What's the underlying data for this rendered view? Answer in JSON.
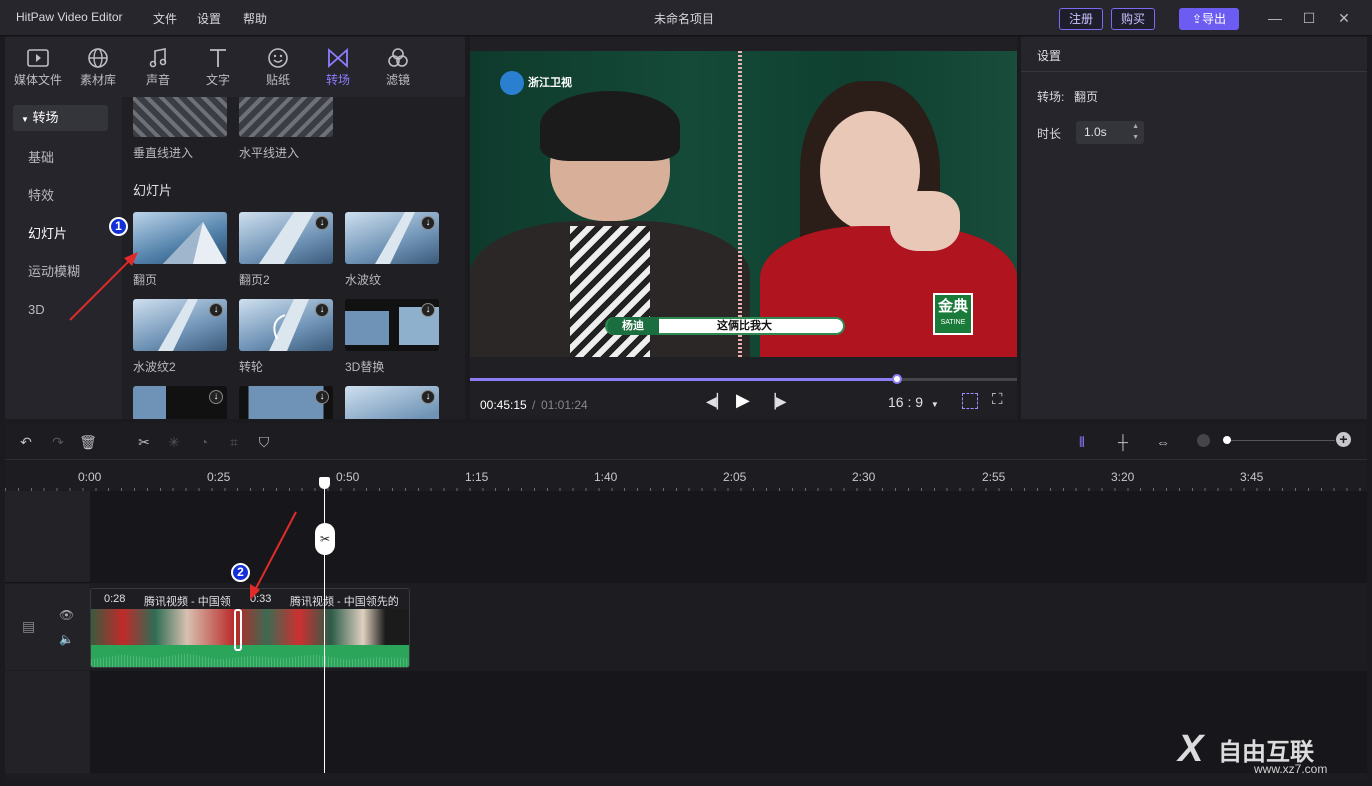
{
  "app": {
    "title": "HitPaw Video Editor",
    "project_name": "未命名项目"
  },
  "menu": [
    "文件",
    "设置",
    "帮助"
  ],
  "header": {
    "register": "注册",
    "buy": "购买",
    "export": "导出"
  },
  "tabs": [
    {
      "label": "媒体文件",
      "icon": "media-icon"
    },
    {
      "label": "素材库",
      "icon": "globe-icon"
    },
    {
      "label": "声音",
      "icon": "music-icon"
    },
    {
      "label": "文字",
      "icon": "text-icon"
    },
    {
      "label": "贴纸",
      "icon": "sticker-icon"
    },
    {
      "label": "转场",
      "icon": "transition-icon",
      "active": true
    },
    {
      "label": "滤镜",
      "icon": "filter-icon"
    }
  ],
  "categories": {
    "header": "转场",
    "items": [
      "基础",
      "特效",
      "幻灯片",
      "运动模糊",
      "3D"
    ],
    "selected": "幻灯片"
  },
  "grid": {
    "top_labels": [
      "垂直线进入",
      "水平线进入"
    ],
    "section_title": "幻灯片",
    "items": [
      "翻页",
      "翻页2",
      "水波纹",
      "水波纹2",
      "转轮",
      "3D替换"
    ]
  },
  "annotations": [
    "1",
    "2"
  ],
  "video": {
    "channel_logo": "浙江卫视",
    "caption_name": "杨迪",
    "caption_text": "这俩比我大",
    "sponsor": "金典",
    "sponsor_sub": "SATINE"
  },
  "player": {
    "current_time": "00:45:15",
    "separator": "/",
    "total_time": "01:01:24",
    "aspect": "16 : 9",
    "progress": 0.78
  },
  "settings": {
    "title": "设置",
    "transition_label": "转场:",
    "transition_value": "翻页",
    "duration_label": "时长",
    "duration_value": "1.0s"
  },
  "ruler": [
    "0:00",
    "0:25",
    "0:50",
    "1:15",
    "1:40",
    "2:05",
    "2:30",
    "2:55",
    "3:20",
    "3:45"
  ],
  "clips": [
    {
      "time": "0:28",
      "title": "腾讯视频 - 中国领"
    },
    {
      "time": "0:33",
      "title": "腾讯视频 - 中国领先的"
    }
  ],
  "watermark": {
    "brand": "自由互联",
    "url": "www.xz7.com"
  }
}
